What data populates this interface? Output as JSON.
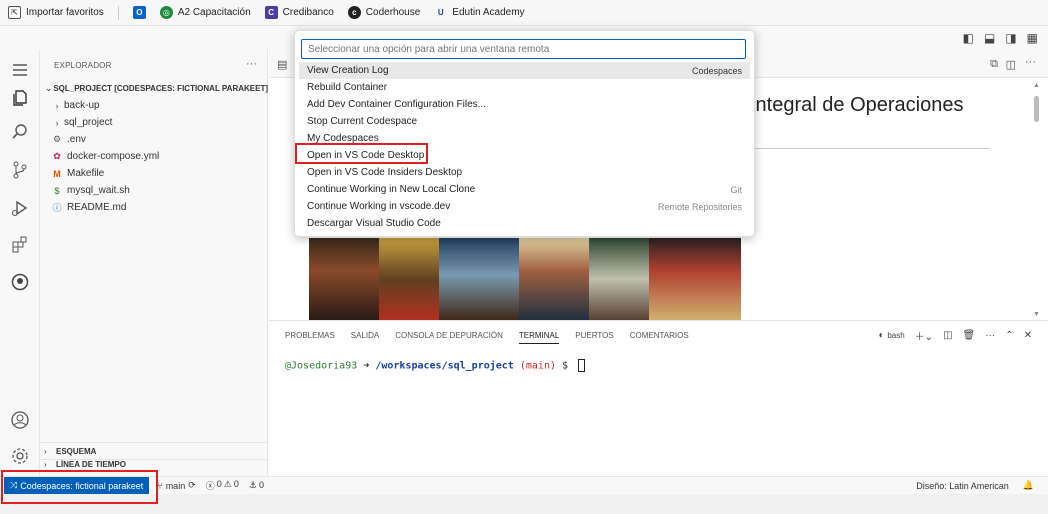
{
  "bookmarks": [
    {
      "label": "Importar favoritos",
      "icon": "import-icon"
    },
    {
      "label": "",
      "icon": "outlook-icon"
    },
    {
      "label": "A2 Capacitación",
      "icon": "a2-icon"
    },
    {
      "label": "Credibanco",
      "icon": "credibanco-icon"
    },
    {
      "label": "Coderhouse",
      "icon": "coderhouse-icon"
    },
    {
      "label": "Edutin Academy",
      "icon": "edutin-icon"
    }
  ],
  "sidebar": {
    "title": "EXPLORADOR",
    "root": "SQL_PROJECT [CODESPACES: FICTIONAL PARAKEET]",
    "items": [
      {
        "label": "back-up",
        "type": "folder"
      },
      {
        "label": "sql_project",
        "type": "folder"
      },
      {
        "label": ".env",
        "type": "gear"
      },
      {
        "label": "docker-compose.yml",
        "type": "docker"
      },
      {
        "label": "Makefile",
        "type": "make"
      },
      {
        "label": "mysql_wait.sh",
        "type": "shell"
      },
      {
        "label": "README.md",
        "type": "info"
      }
    ],
    "outline": "ESQUEMA",
    "timeline": "LÍNEA DE TIEMPO"
  },
  "editor": {
    "heading": "Integral de Operaciones"
  },
  "quickpick": {
    "placeholder": "Seleccionar una opción para abrir una ventana remota",
    "items": [
      {
        "label": "View Creation Log",
        "desc": "Codespaces"
      },
      {
        "label": "Rebuild Container",
        "desc": ""
      },
      {
        "label": "Add Dev Container Configuration Files...",
        "desc": ""
      },
      {
        "label": "Stop Current Codespace",
        "desc": ""
      },
      {
        "label": "My Codespaces",
        "desc": ""
      },
      {
        "label": "Open in VS Code Desktop",
        "desc": ""
      },
      {
        "label": "Open in VS Code Insiders Desktop",
        "desc": ""
      },
      {
        "label": "Continue Working in New Local Clone",
        "desc": "Git"
      },
      {
        "label": "Continue Working in vscode.dev",
        "desc": "Remote Repositories"
      },
      {
        "label": "Descargar Visual Studio Code",
        "desc": ""
      }
    ]
  },
  "panel": {
    "tabs": [
      "PROBLEMAS",
      "SALIDA",
      "CONSOLA DE DEPURACIÓN",
      "TERMINAL",
      "PUERTOS",
      "COMENTARIOS"
    ],
    "active_tab": "TERMINAL",
    "shell": "bash",
    "prompt_user": "@Josedoria93",
    "prompt_arrow": "➜",
    "prompt_path": "/workspaces/sql_project",
    "prompt_branch": "(main)",
    "prompt_symbol": "$"
  },
  "statusbar": {
    "remote": "Codespaces: fictional parakeet",
    "branch": "main",
    "errors": "0",
    "warnings": "0",
    "ports": "0",
    "layout": "Diseño: Latin American"
  },
  "colors": {
    "accent": "#005fb8",
    "highlight_box": "#e02020"
  }
}
